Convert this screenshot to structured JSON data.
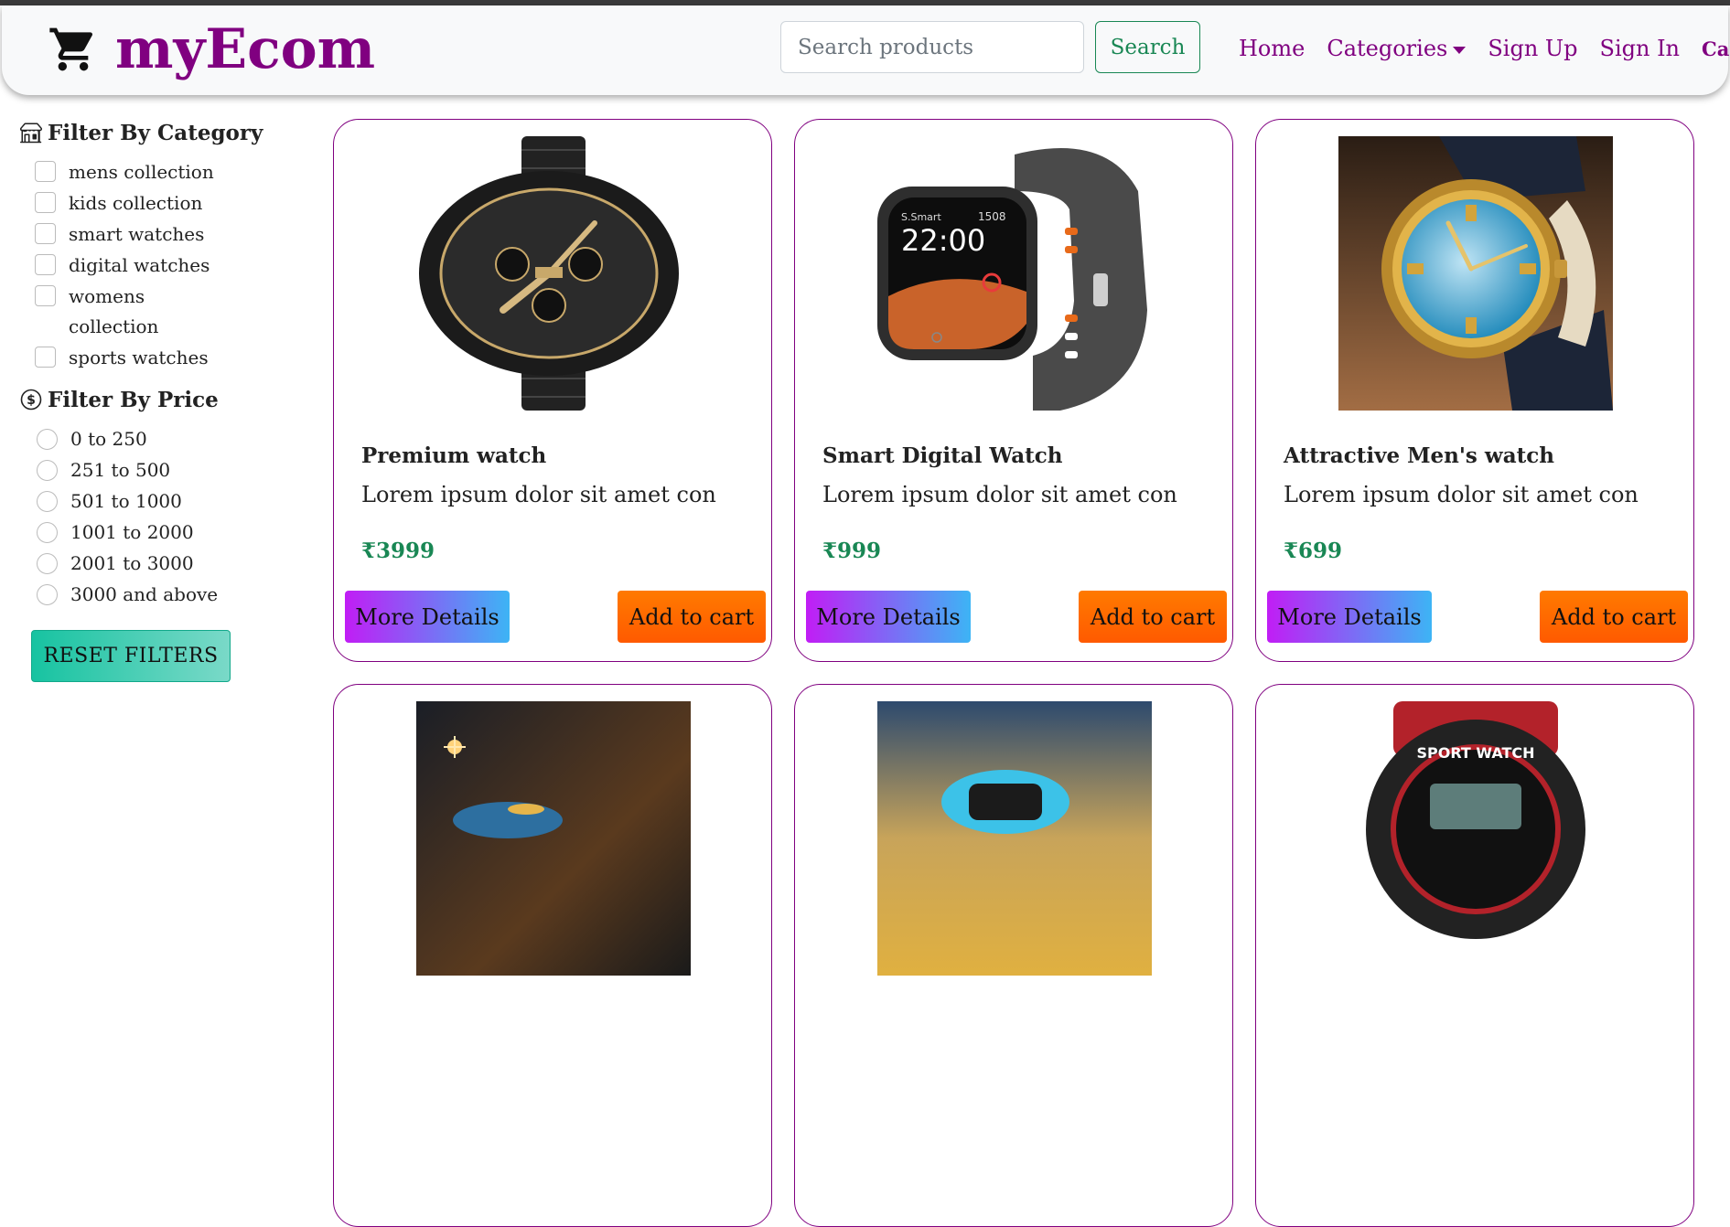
{
  "brand": {
    "name": "myEcom",
    "icon": "cart-icon"
  },
  "search": {
    "placeholder": "Search products",
    "button": "Search"
  },
  "nav": {
    "home": "Home",
    "categories": "Categories",
    "signup": "Sign Up",
    "signin": "Sign In",
    "cart": "Cart"
  },
  "colors": {
    "brand": "#800080",
    "success": "#198754",
    "cart_button": "#ff6a00",
    "details_start": "#c11df5",
    "details_end": "#3db4f5",
    "reset": "#20c997"
  },
  "sidebar": {
    "category_title": "Filter By Category",
    "categories": [
      "mens collection",
      "kids collection",
      "smart watches",
      "digital watches",
      "womens collection",
      "sports watches"
    ],
    "price_title": "Filter By Price",
    "prices": [
      "0 to 250",
      "251 to 500",
      "501 to 1000",
      "1001 to 2000",
      "2001 to 3000",
      "3000 and above"
    ],
    "reset": "RESET FILTERS"
  },
  "products": [
    {
      "title": "Premium watch",
      "desc": "Lorem ipsum dolor sit amet con",
      "price": "₹3999",
      "details": "More Details",
      "cart": "Add to cart"
    },
    {
      "title": "Smart Digital Watch",
      "desc": "Lorem ipsum dolor sit amet con",
      "price": "₹999",
      "details": "More Details",
      "cart": "Add to cart"
    },
    {
      "title": "Attractive Men's watch",
      "desc": "Lorem ipsum dolor sit amet con",
      "price": "₹699",
      "details": "More Details",
      "cart": "Add to cart"
    }
  ]
}
